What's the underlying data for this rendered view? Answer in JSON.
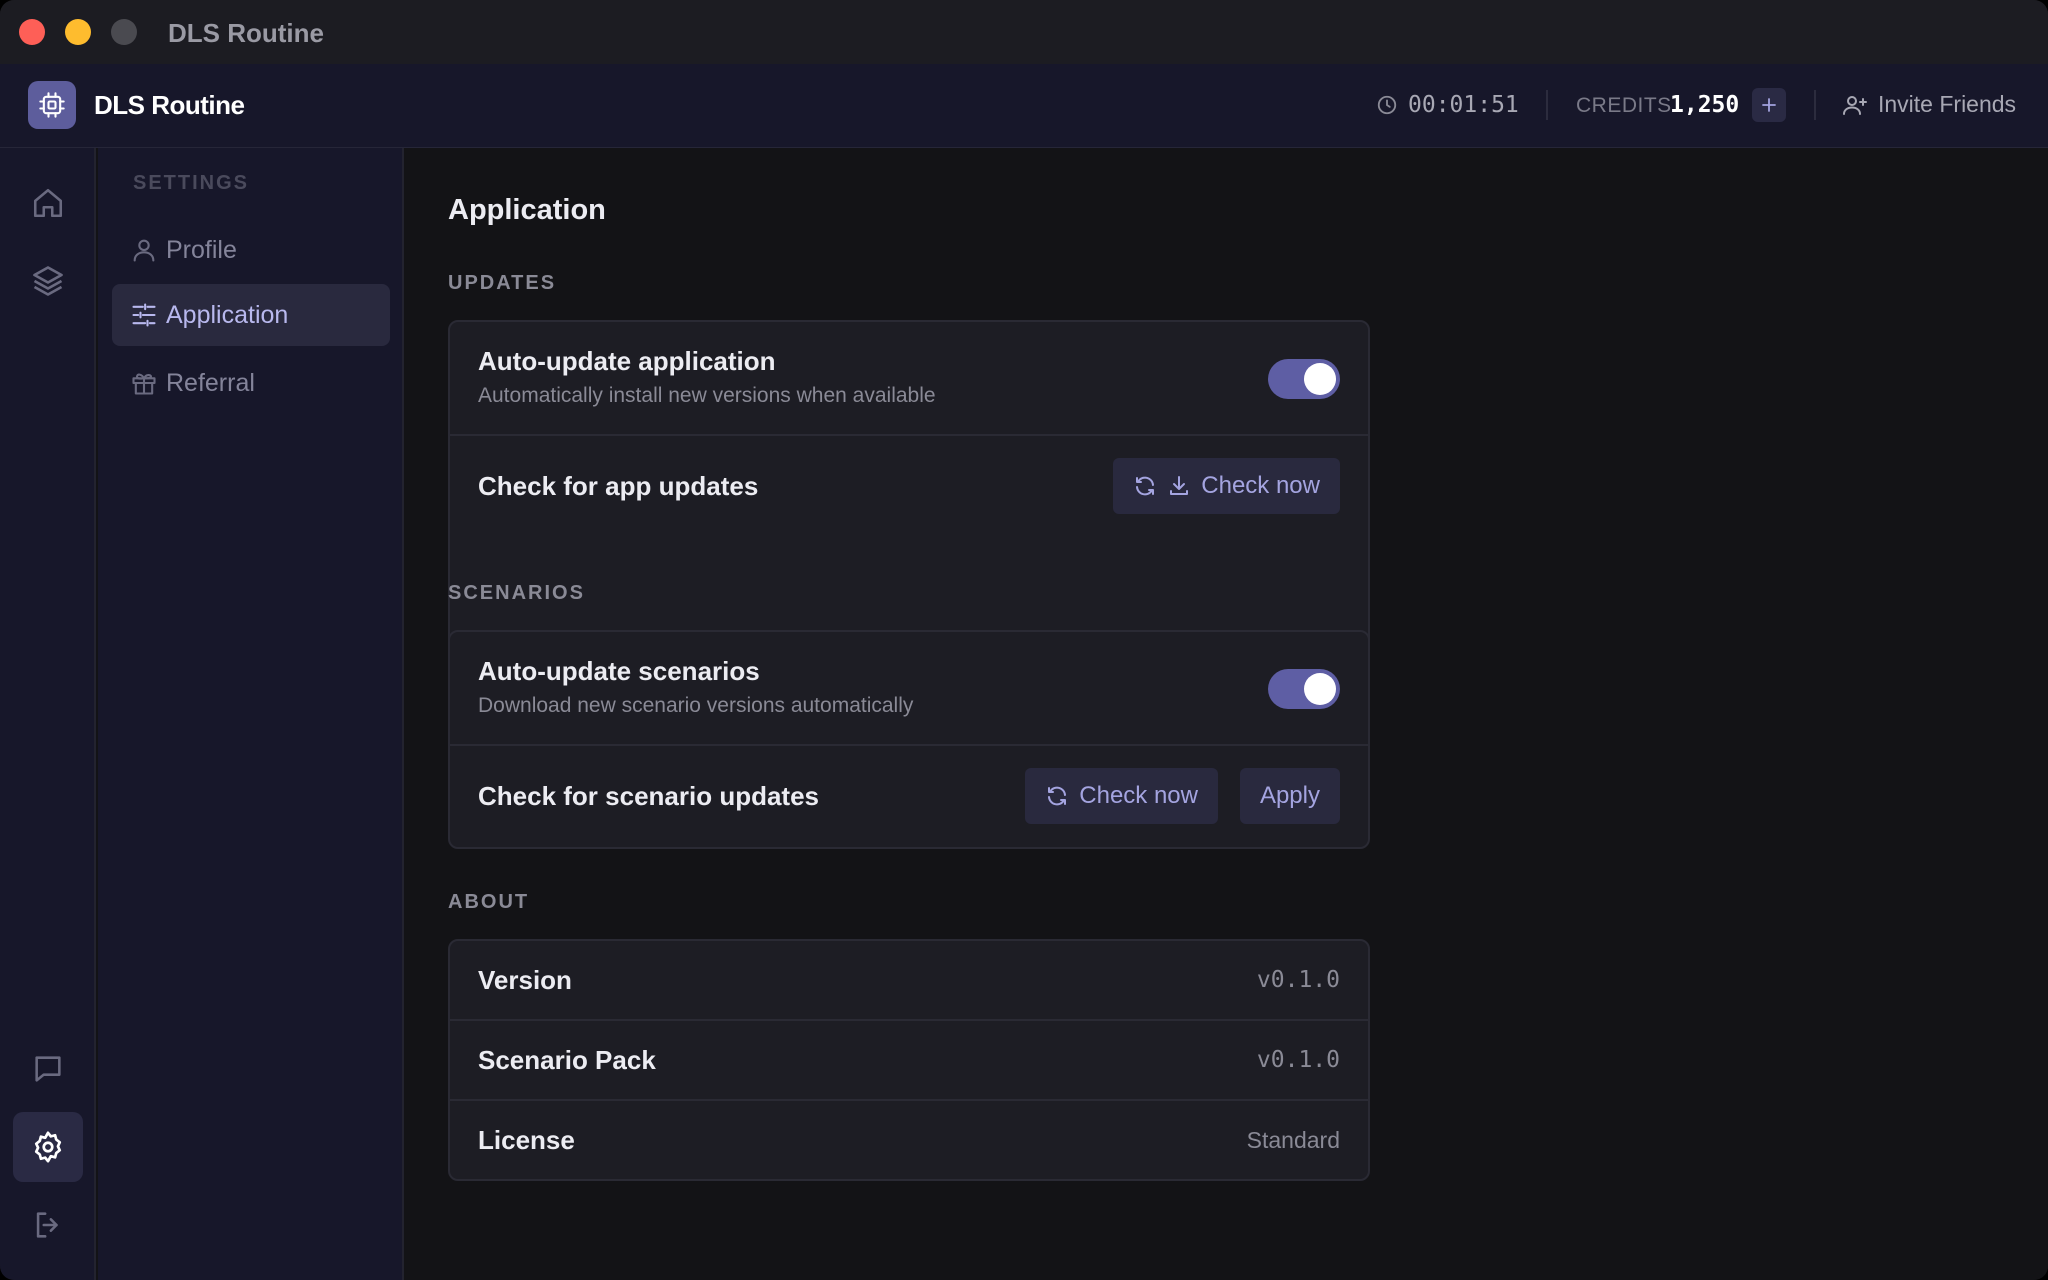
{
  "window": {
    "title": "DLS Routine"
  },
  "header": {
    "app_name": "DLS Routine",
    "timer": "00:01:51",
    "credits_label": "CREDITS",
    "credits_value": "1,250",
    "invite_label": "Invite Friends"
  },
  "rail": {
    "items": [
      {
        "icon": "home-icon"
      },
      {
        "icon": "layers-icon"
      },
      {
        "icon": "chat-icon"
      },
      {
        "icon": "gear-icon",
        "active": true
      },
      {
        "icon": "logout-icon"
      }
    ]
  },
  "settings_nav": {
    "heading": "SETTINGS",
    "items": [
      {
        "label": "Profile",
        "icon": "user-icon"
      },
      {
        "label": "Application",
        "icon": "sliders-icon",
        "active": true
      },
      {
        "label": "Referral",
        "icon": "gift-icon"
      }
    ]
  },
  "main": {
    "title": "Application",
    "updates": {
      "label": "UPDATES",
      "auto_title": "Auto-update application",
      "auto_sub": "Automatically install new versions when available",
      "auto_enabled": true,
      "check_title": "Check for app updates",
      "check_button": "Check now"
    },
    "scenarios": {
      "label": "SCENARIOS",
      "auto_title": "Auto-update scenarios",
      "auto_sub": "Download new scenario versions automatically",
      "auto_enabled": true,
      "check_title": "Check for scenario updates",
      "check_button": "Check now",
      "apply_button": "Apply"
    },
    "about": {
      "label": "ABOUT",
      "rows": [
        {
          "label": "Version",
          "value": "v0.1.0"
        },
        {
          "label": "Scenario Pack",
          "value": "v0.1.0"
        },
        {
          "label": "License",
          "value": "Standard"
        }
      ]
    }
  },
  "colors": {
    "accent": "#5e5ea4",
    "background": "#131316",
    "sidebar": "#17172a"
  }
}
